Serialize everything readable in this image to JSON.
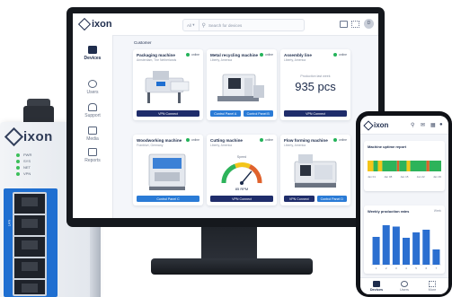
{
  "router": {
    "logo_text": "ixon",
    "led_labels": [
      "PWR",
      "SYS",
      "NET",
      "VPN"
    ],
    "port_label": "LAN"
  },
  "app": {
    "brand": "ixon",
    "search": {
      "scope": "All",
      "placeholder": "Search for devices"
    },
    "user_initial": "D",
    "sidebar": [
      {
        "label": "Devices",
        "icon": "devices-icon",
        "active": true
      },
      {
        "label": "Users",
        "icon": "users-icon",
        "active": false
      },
      {
        "label": "Support",
        "icon": "headset-icon",
        "active": false
      },
      {
        "label": "Media",
        "icon": "media-icon",
        "active": false
      },
      {
        "label": "Reports",
        "icon": "reports-icon",
        "active": false
      }
    ],
    "breadcrumb": "Customer",
    "status_online": "online",
    "cards": [
      {
        "title": "Packaging machine",
        "subtitle": "Amsterdam, The Netherlands",
        "buttons": [
          "VPN Connect"
        ]
      },
      {
        "title": "Metal recycling machine",
        "subtitle": "Liberty, America",
        "buttons": [
          "Control Panel A",
          "Control Panel B"
        ]
      },
      {
        "title": "Assembly line",
        "subtitle": "Liberty, America",
        "metric_label": "Production last week",
        "metric_value": "935 pcs",
        "buttons": [
          "VPN Connect"
        ]
      },
      {
        "title": "Woodworking machine",
        "subtitle": "Frankfurt, Germany",
        "buttons": [
          "Control Panel C"
        ]
      },
      {
        "title": "Cutting machine",
        "subtitle": "Liberty, America",
        "gauge_label": "Speed",
        "gauge_value": "85 RPM",
        "gauge_fraction": 0.72,
        "buttons": [
          "VPN Connect"
        ]
      },
      {
        "title": "Flow forming machine",
        "subtitle": "Liberty, America",
        "buttons": [
          "VPN Connect",
          "Control Panel D"
        ]
      }
    ]
  },
  "phone": {
    "brand": "ixon",
    "uptime_title": "Machine uptime report",
    "uptime_axis": [
      "Jan 01",
      "Jan 08",
      "Jan 15",
      "Jan 22",
      "Jan 29"
    ],
    "production_title": "Weekly production rates",
    "production_meta": "Week",
    "nav": [
      {
        "label": "Devices",
        "active": true
      },
      {
        "label": "Users",
        "active": false
      },
      {
        "label": "More",
        "active": false
      }
    ]
  },
  "chart_data": {
    "type": "bar",
    "title": "Weekly production rates",
    "categories": [
      "1",
      "2",
      "3",
      "4",
      "5",
      "6",
      "7"
    ],
    "values": [
      62,
      88,
      85,
      60,
      72,
      78,
      34
    ],
    "ylim": [
      0,
      100
    ],
    "color": "#2b6fd0"
  },
  "uptime_segments": [
    {
      "color": "#f3c51a",
      "fraction": 0.08
    },
    {
      "color": "#2db35a",
      "fraction": 0.06
    },
    {
      "color": "#f3c51a",
      "fraction": 0.06
    },
    {
      "color": "#2db35a",
      "fraction": 0.2
    },
    {
      "color": "#e0622c",
      "fraction": 0.03
    },
    {
      "color": "#2db35a",
      "fraction": 0.1
    },
    {
      "color": "#f3c51a",
      "fraction": 0.05
    },
    {
      "color": "#2db35a",
      "fraction": 0.22
    },
    {
      "color": "#e0622c",
      "fraction": 0.04
    },
    {
      "color": "#2db35a",
      "fraction": 0.16
    }
  ],
  "colors": {
    "navy": "#1f2d6b",
    "blue": "#2a7bd6",
    "online": "#24b35a"
  }
}
